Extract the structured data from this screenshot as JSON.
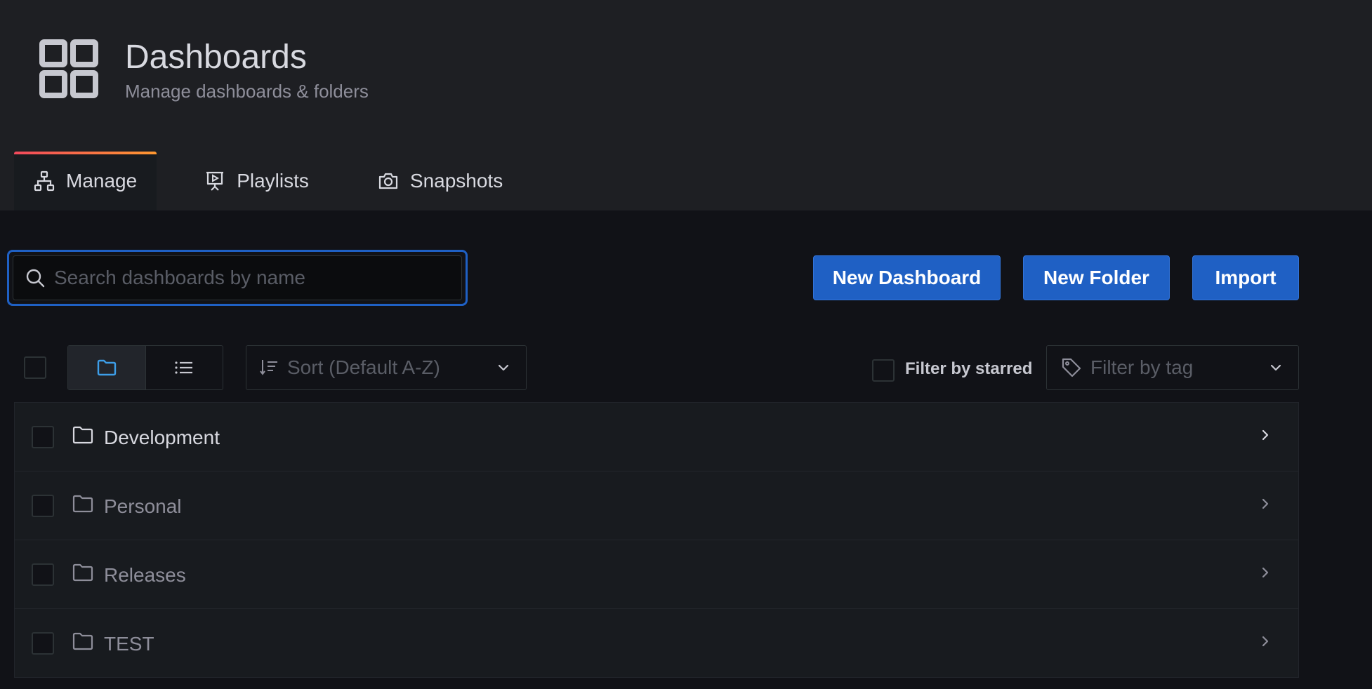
{
  "header": {
    "title": "Dashboards",
    "subtitle": "Manage dashboards & folders",
    "icon": "dashboards-grid-icon"
  },
  "tabs": [
    {
      "label": "Manage",
      "icon": "sitemap-icon",
      "active": true
    },
    {
      "label": "Playlists",
      "icon": "presentation-play-icon",
      "active": false
    },
    {
      "label": "Snapshots",
      "icon": "camera-icon",
      "active": false
    }
  ],
  "search": {
    "placeholder": "Search dashboards by name",
    "value": ""
  },
  "actions": {
    "new_dashboard": "New Dashboard",
    "new_folder": "New Folder",
    "import": "Import"
  },
  "filters": {
    "view_mode": "folders",
    "sort_placeholder": "Sort (Default A-Z)",
    "starred_label": "Filter by starred",
    "starred_checked": false,
    "tag_placeholder": "Filter by tag"
  },
  "folders": [
    {
      "name": "Development"
    },
    {
      "name": "Personal"
    },
    {
      "name": "Releases"
    },
    {
      "name": "TEST"
    }
  ],
  "colors": {
    "primary": "#1f60c4",
    "tab_accent_start": "#f2495c",
    "tab_accent_end": "#ff9830",
    "active_view_icon": "#3d9ee8"
  }
}
